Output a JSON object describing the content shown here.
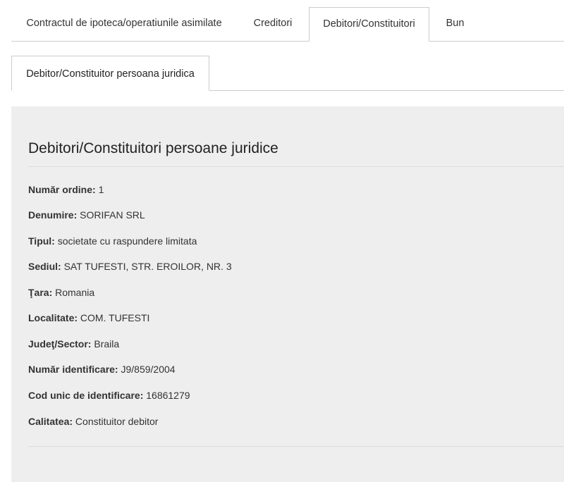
{
  "tabs": [
    {
      "label": "Contractul de ipoteca/operatiunile asimilate",
      "active": false
    },
    {
      "label": "Creditori",
      "active": false
    },
    {
      "label": "Debitori/Constituitori",
      "active": true
    },
    {
      "label": "Bun",
      "active": false
    }
  ],
  "subtabs": [
    {
      "label": "Debitor/Constituitor persoana juridica",
      "active": true
    }
  ],
  "section": {
    "title": "Debitori/Constituitori persoane juridice"
  },
  "fields": [
    {
      "label": "Număr ordine:",
      "value": "1"
    },
    {
      "label": "Denumire:",
      "value": "SORIFAN SRL"
    },
    {
      "label": "Tipul:",
      "value": "societate cu raspundere limitata"
    },
    {
      "label": "Sediul:",
      "value": "SAT TUFESTI, STR. EROILOR, NR. 3"
    },
    {
      "label": "Ţara:",
      "value": "Romania"
    },
    {
      "label": "Localitate:",
      "value": "COM. TUFESTI"
    },
    {
      "label": "Judeţ/Sector:",
      "value": "Braila"
    },
    {
      "label": "Număr identificare:",
      "value": "J9/859/2004"
    },
    {
      "label": "Cod unic de identificare:",
      "value": "16861279"
    },
    {
      "label": "Calitatea:",
      "value": "Constituitor debitor"
    }
  ]
}
